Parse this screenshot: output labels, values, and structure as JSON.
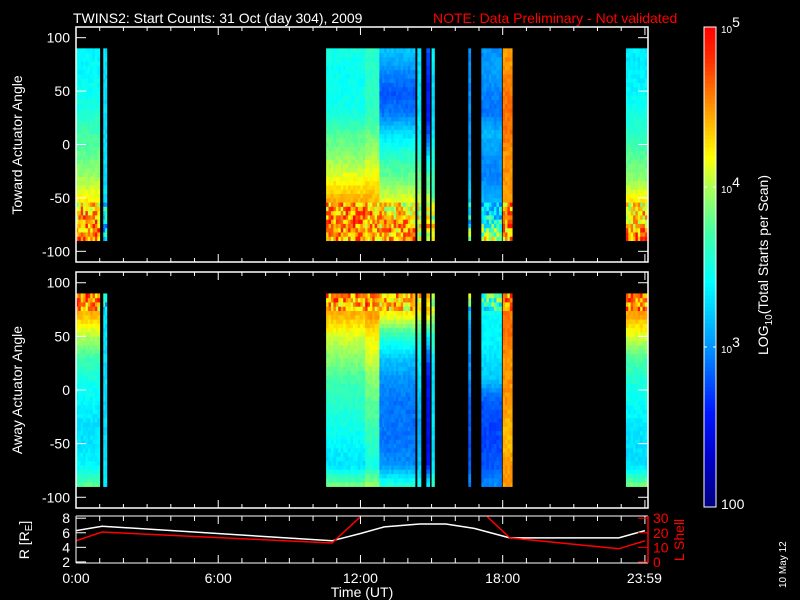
{
  "title": {
    "main": "TWINS2: Start Counts: 31 Oct (day 304), 2009",
    "note": "NOTE: Data Preliminary - Not validated",
    "note_color": "#ff0000"
  },
  "footer_date": "10 May 12",
  "colorbar": {
    "label_prefix": "LOG",
    "label_sub": "10",
    "label_suffix": "(Total Starts per Scan)",
    "range_log10": [
      2,
      5
    ],
    "ticks": [
      {
        "value": 5,
        "base": "10",
        "exp": "5"
      },
      {
        "value": 4,
        "base": "10",
        "exp": "4"
      },
      {
        "value": 3,
        "base": "10",
        "exp": "3"
      },
      {
        "value": 2,
        "base": "100",
        "exp": ""
      }
    ],
    "colormap": [
      {
        "v": 0.0,
        "c": "#000080"
      },
      {
        "v": 0.1,
        "c": "#0000c8"
      },
      {
        "v": 0.2,
        "c": "#0018ff"
      },
      {
        "v": 0.33,
        "c": "#0090ff"
      },
      {
        "v": 0.47,
        "c": "#00ffff"
      },
      {
        "v": 0.57,
        "c": "#40ffa8"
      },
      {
        "v": 0.67,
        "c": "#b0ff50"
      },
      {
        "v": 0.73,
        "c": "#ffff00"
      },
      {
        "v": 0.83,
        "c": "#ff9800"
      },
      {
        "v": 0.93,
        "c": "#ff3000"
      },
      {
        "v": 1.0,
        "c": "#ff0000"
      }
    ]
  },
  "chart_data": [
    {
      "type": "heatmap",
      "panel": "toward",
      "ylabel": "Toward Actuator Angle",
      "ylim": [
        -110,
        110
      ],
      "yticks": [
        100,
        50,
        0,
        -50,
        -100
      ],
      "xlim_hours": [
        0,
        24.13
      ],
      "angle_knots": [
        -90,
        -70,
        -50,
        -30,
        -10,
        10,
        30,
        50,
        70,
        90
      ],
      "segments_log10": [
        {
          "start": 0.0,
          "end": 1.0,
          "profile": [
            4.6,
            4.5,
            4.2,
            3.95,
            3.8,
            3.7,
            3.55,
            3.45,
            3.4,
            3.4
          ]
        },
        {
          "start": 1.15,
          "end": 1.3,
          "profile": [
            3.3,
            3.3,
            3.3,
            3.3,
            3.3,
            3.3,
            3.3,
            3.3,
            3.3,
            3.3
          ]
        },
        {
          "start": 10.55,
          "end": 12.2,
          "profile": [
            4.5,
            4.6,
            4.4,
            4.15,
            3.9,
            3.75,
            3.5,
            3.45,
            3.45,
            3.5
          ]
        },
        {
          "start": 12.2,
          "end": 12.8,
          "profile": [
            4.5,
            4.5,
            4.4,
            4.2,
            4.0,
            3.8,
            3.65,
            3.6,
            3.6,
            3.6
          ]
        },
        {
          "start": 12.8,
          "end": 14.3,
          "profile": [
            4.5,
            4.4,
            4.1,
            3.8,
            3.6,
            3.3,
            2.9,
            2.8,
            3.0,
            3.2
          ]
        },
        {
          "start": 14.4,
          "end": 14.55,
          "profile": [
            4.2,
            4.1,
            4.0,
            3.8,
            3.6,
            3.4,
            3.3,
            3.3,
            3.3,
            3.3
          ]
        },
        {
          "start": 14.78,
          "end": 14.92,
          "profile": [
            4.3,
            4.2,
            4.0,
            3.7,
            3.3,
            2.8,
            2.6,
            2.6,
            2.7,
            2.8
          ]
        },
        {
          "start": 15.0,
          "end": 15.12,
          "profile": [
            4.2,
            4.0,
            3.8,
            3.6,
            3.5,
            3.35,
            3.3,
            3.3,
            3.3,
            3.4
          ]
        },
        {
          "start": 16.55,
          "end": 16.65,
          "profile": [
            3.9,
            3.3,
            3.2,
            3.1,
            3.05,
            3.0,
            3.0,
            3.0,
            3.0,
            3.0
          ]
        },
        {
          "start": 17.1,
          "end": 17.95,
          "profile": [
            4.2,
            3.4,
            3.1,
            2.95,
            3.0,
            3.15,
            2.9,
            2.95,
            3.05,
            3.0
          ]
        },
        {
          "start": 18.0,
          "end": 18.4,
          "profile": [
            4.5,
            4.5,
            4.5,
            4.5,
            4.5,
            4.6,
            4.6,
            4.6,
            4.5,
            4.5
          ]
        },
        {
          "start": 23.2,
          "end": 24.1,
          "profile": [
            4.6,
            4.4,
            4.2,
            3.9,
            3.75,
            3.6,
            3.5,
            3.4,
            3.35,
            3.35
          ]
        }
      ]
    },
    {
      "type": "heatmap",
      "panel": "away",
      "ylabel": "Away Actuator Angle",
      "ylim": [
        -110,
        110
      ],
      "yticks": [
        100,
        50,
        0,
        -50,
        -100
      ],
      "xlim_hours": [
        0,
        24.13
      ],
      "angle_knots": [
        -90,
        -70,
        -50,
        -30,
        -10,
        10,
        30,
        50,
        70,
        90
      ],
      "segments_log10": [
        {
          "start": 0.0,
          "end": 1.0,
          "profile": [
            3.8,
            3.4,
            3.3,
            3.3,
            3.4,
            3.5,
            3.7,
            4.0,
            4.4,
            4.6
          ]
        },
        {
          "start": 1.15,
          "end": 1.3,
          "profile": [
            3.3,
            3.3,
            3.3,
            3.3,
            3.3,
            3.3,
            3.3,
            3.3,
            3.3,
            3.3
          ]
        },
        {
          "start": 10.55,
          "end": 12.2,
          "profile": [
            3.9,
            3.3,
            3.4,
            3.5,
            3.6,
            3.7,
            3.9,
            4.1,
            4.4,
            4.6
          ]
        },
        {
          "start": 12.2,
          "end": 12.8,
          "profile": [
            4.0,
            3.5,
            3.6,
            3.7,
            3.8,
            3.9,
            4.1,
            4.2,
            4.5,
            4.6
          ]
        },
        {
          "start": 12.8,
          "end": 14.3,
          "profile": [
            3.6,
            3.0,
            2.9,
            2.9,
            2.9,
            3.0,
            3.2,
            3.6,
            4.2,
            4.5
          ]
        },
        {
          "start": 14.4,
          "end": 14.55,
          "profile": [
            3.5,
            3.2,
            3.1,
            3.1,
            3.2,
            3.3,
            3.4,
            3.6,
            4.1,
            4.4
          ]
        },
        {
          "start": 14.78,
          "end": 14.92,
          "profile": [
            3.5,
            2.6,
            2.5,
            2.5,
            2.5,
            2.6,
            2.8,
            3.4,
            4.3,
            4.5
          ]
        },
        {
          "start": 15.0,
          "end": 15.12,
          "profile": [
            3.6,
            3.3,
            3.3,
            3.3,
            3.3,
            3.3,
            3.4,
            3.6,
            4.0,
            4.3
          ]
        },
        {
          "start": 16.55,
          "end": 16.65,
          "profile": [
            3.0,
            2.8,
            2.8,
            2.8,
            2.8,
            3.0,
            3.0,
            3.05,
            3.2,
            3.9
          ]
        },
        {
          "start": 17.1,
          "end": 17.95,
          "profile": [
            3.0,
            2.8,
            2.75,
            2.75,
            2.8,
            3.2,
            3.3,
            3.4,
            3.4,
            3.8
          ]
        },
        {
          "start": 18.0,
          "end": 18.4,
          "profile": [
            4.5,
            4.5,
            4.4,
            4.4,
            4.5,
            4.5,
            4.5,
            4.6,
            4.6,
            4.5
          ]
        },
        {
          "start": 23.2,
          "end": 24.1,
          "profile": [
            3.9,
            3.3,
            3.3,
            3.35,
            3.45,
            3.55,
            3.75,
            4.1,
            4.45,
            4.6
          ]
        }
      ]
    },
    {
      "type": "line",
      "panel": "orbit",
      "xlabel": "Time (UT)",
      "xticks": [
        {
          "value": 0,
          "label": "0:00"
        },
        {
          "value": 6,
          "label": "6:00"
        },
        {
          "value": 12,
          "label": "12:00"
        },
        {
          "value": 18,
          "label": "18:00"
        },
        {
          "value": 23.98,
          "label": "23:59"
        }
      ],
      "ylabel_left_prefix": "R [R",
      "ylabel_left_sub": "E",
      "ylabel_left_suffix": "]",
      "ylim_left": [
        1.85,
        8.3
      ],
      "yticks_left": [
        8,
        6,
        4,
        2
      ],
      "ylabel_right": "L Shell",
      "ylim_right": [
        0,
        30
      ],
      "yticks_right": [
        30,
        20,
        10,
        0
      ],
      "series": [
        {
          "name": "R",
          "color": "#ffffff",
          "axis": "left",
          "points": [
            [
              0,
              6.3
            ],
            [
              1.1,
              6.9
            ],
            [
              10.8,
              4.9
            ],
            [
              12,
              5.9
            ],
            [
              13,
              6.8
            ],
            [
              14.5,
              7.2
            ],
            [
              15.6,
              7.2
            ],
            [
              16.8,
              6.6
            ],
            [
              18.3,
              5.3
            ],
            [
              22.9,
              5.3
            ],
            [
              24,
              6.3
            ]
          ]
        },
        {
          "name": "L Shell",
          "color": "#ff0000",
          "axis": "right",
          "points": [
            [
              0,
              14.5
            ],
            [
              1.1,
              20.5
            ],
            [
              10.8,
              13
            ],
            [
              12.0,
              31
            ],
            null,
            [
              17.35,
              31
            ],
            [
              18.3,
              16.5
            ],
            [
              22.9,
              9
            ],
            [
              24,
              14.5
            ]
          ]
        }
      ]
    }
  ]
}
